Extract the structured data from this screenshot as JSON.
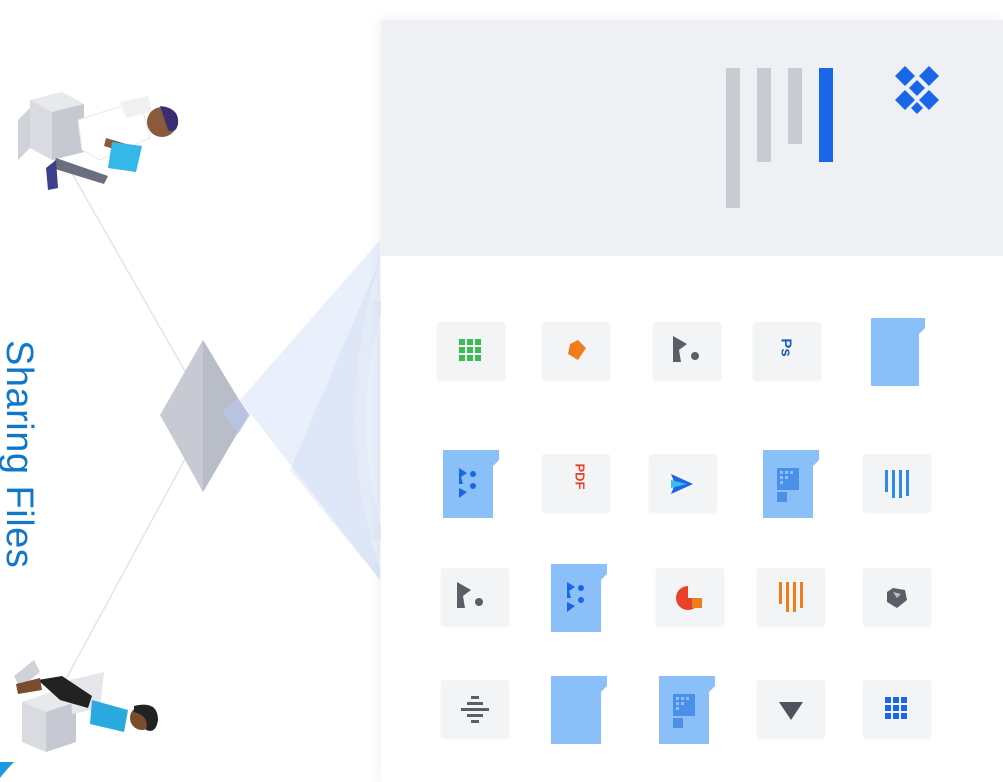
{
  "title": "Sharing Files",
  "colors": {
    "accent": "#1177c8",
    "folder_blue": "#8bbff7",
    "brand_blue": "#1966e6",
    "sheet_green": "#3dbb55",
    "orange": "#f07d1b",
    "red": "#e8432a",
    "gray_bar": "#c8ccd2"
  },
  "icons": [
    "dropbox-logo-icon",
    "signal-bars-icon",
    "spreadsheet-grid-icon",
    "orange-diamond-icon",
    "keynote-icon",
    "photoshop-icon",
    "folder-icon",
    "shared-folder-icon",
    "pdf-icon",
    "affinity-icon",
    "grid-folder-icon",
    "vertical-bars-icon",
    "pie-chart-icon",
    "gem-icon",
    "strikethrough-icon",
    "triangle-down-icon",
    "grid-icon"
  ],
  "pdf_label": "PDF",
  "ps_label": "Ps"
}
